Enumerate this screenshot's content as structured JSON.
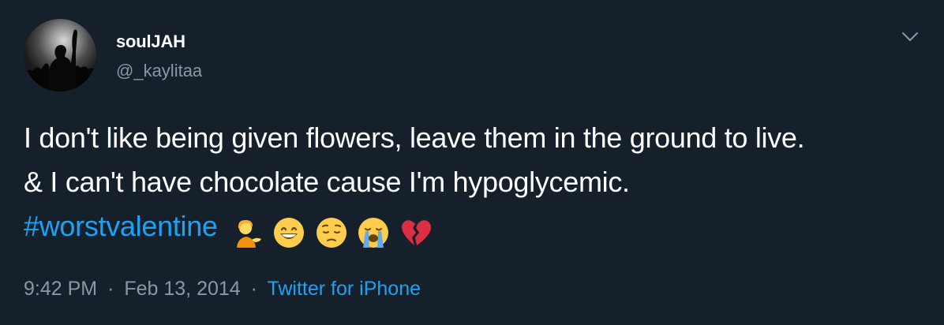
{
  "author": {
    "display_name": "soulJAH",
    "handle": "@_kaylitaa"
  },
  "tweet": {
    "text": "I don't like being given flowers, leave them in the ground to live. & I can't have chocolate cause I'm hypoglycemic.",
    "hashtag": "#worstvalentine",
    "emojis": [
      "person-tipping-hand-icon",
      "grinning-face-icon",
      "pensive-face-icon",
      "loudly-crying-face-icon",
      "broken-heart-icon"
    ]
  },
  "meta": {
    "time": "9:42 PM",
    "separator": "·",
    "date": "Feb 13, 2014",
    "source": "Twitter for iPhone"
  },
  "colors": {
    "background": "#15202b",
    "text": "#ffffff",
    "secondary": "#8899a6",
    "link": "#1da1f2"
  }
}
